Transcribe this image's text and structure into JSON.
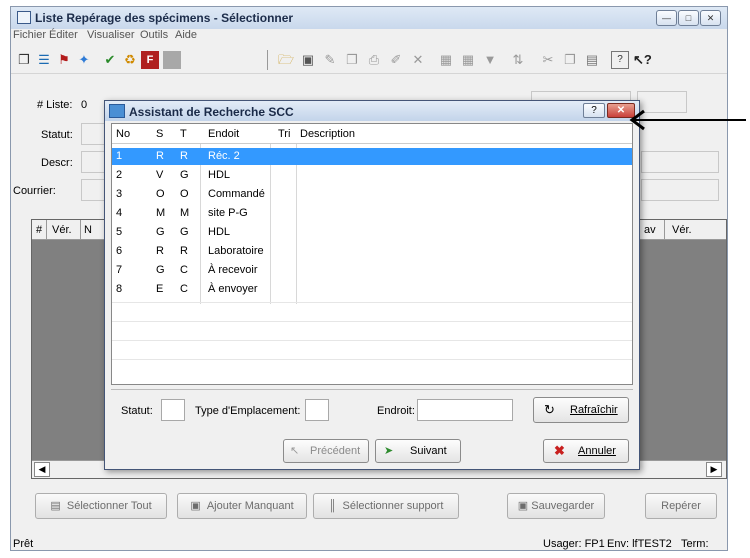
{
  "window": {
    "title": "Liste Repérage des spécimens - Sélectionner",
    "menu": [
      "Fichier",
      "Éditer",
      "Visualiser",
      "Outils",
      "Aide"
    ]
  },
  "form": {
    "liste_label": "# Liste:",
    "liste_value": "0",
    "statut_label": "Statut:",
    "descr_label": "Descr:",
    "courrier_label": "Courrier:"
  },
  "grid": {
    "col_hash": "#",
    "col_ver": "Vér.",
    "col_n": "N",
    "col_av": "av",
    "col_ver2": "Vér."
  },
  "buttons": {
    "select_all": "Sélectionner Tout",
    "add_missing": "Ajouter Manquant",
    "select_support": "Sélectionner support",
    "save": "Sauvegarder",
    "find": "Repérer"
  },
  "status": {
    "left": "Prêt",
    "user": "Usager: FP1",
    "env": "Env: lfTEST2",
    "term": "Term:"
  },
  "dialog": {
    "title": "Assistant de Recherche SCC",
    "help_btn": "?",
    "columns": [
      "No",
      "S",
      "T",
      "Endoit",
      "Tri",
      "Description"
    ],
    "rows": [
      {
        "no": "1",
        "s": "R",
        "t": "R",
        "endoit": "Réc. 2",
        "tri": "",
        "desc": ""
      },
      {
        "no": "2",
        "s": "V",
        "t": "G",
        "endoit": "HDL",
        "tri": "",
        "desc": ""
      },
      {
        "no": "3",
        "s": "O",
        "t": "O",
        "endoit": "Commandé",
        "tri": "",
        "desc": ""
      },
      {
        "no": "4",
        "s": "M",
        "t": "M",
        "endoit": "site P-G",
        "tri": "",
        "desc": ""
      },
      {
        "no": "5",
        "s": "G",
        "t": "G",
        "endoit": "HDL",
        "tri": "",
        "desc": ""
      },
      {
        "no": "6",
        "s": "R",
        "t": "R",
        "endoit": "Laboratoire",
        "tri": "",
        "desc": ""
      },
      {
        "no": "7",
        "s": "G",
        "t": "C",
        "endoit": "À recevoir",
        "tri": "",
        "desc": ""
      },
      {
        "no": "8",
        "s": "E",
        "t": "C",
        "endoit": "À envoyer",
        "tri": "",
        "desc": ""
      }
    ],
    "statut_label": "Statut:",
    "type_label": "Type d'Emplacement:",
    "endroit_label": "Endroit:",
    "refresh": "Rafraîchir",
    "prev": "Précédent",
    "next": "Suivant",
    "cancel": "Annuler"
  },
  "colors": {
    "selection": "#3399ff",
    "close_button": "#c9403a"
  }
}
